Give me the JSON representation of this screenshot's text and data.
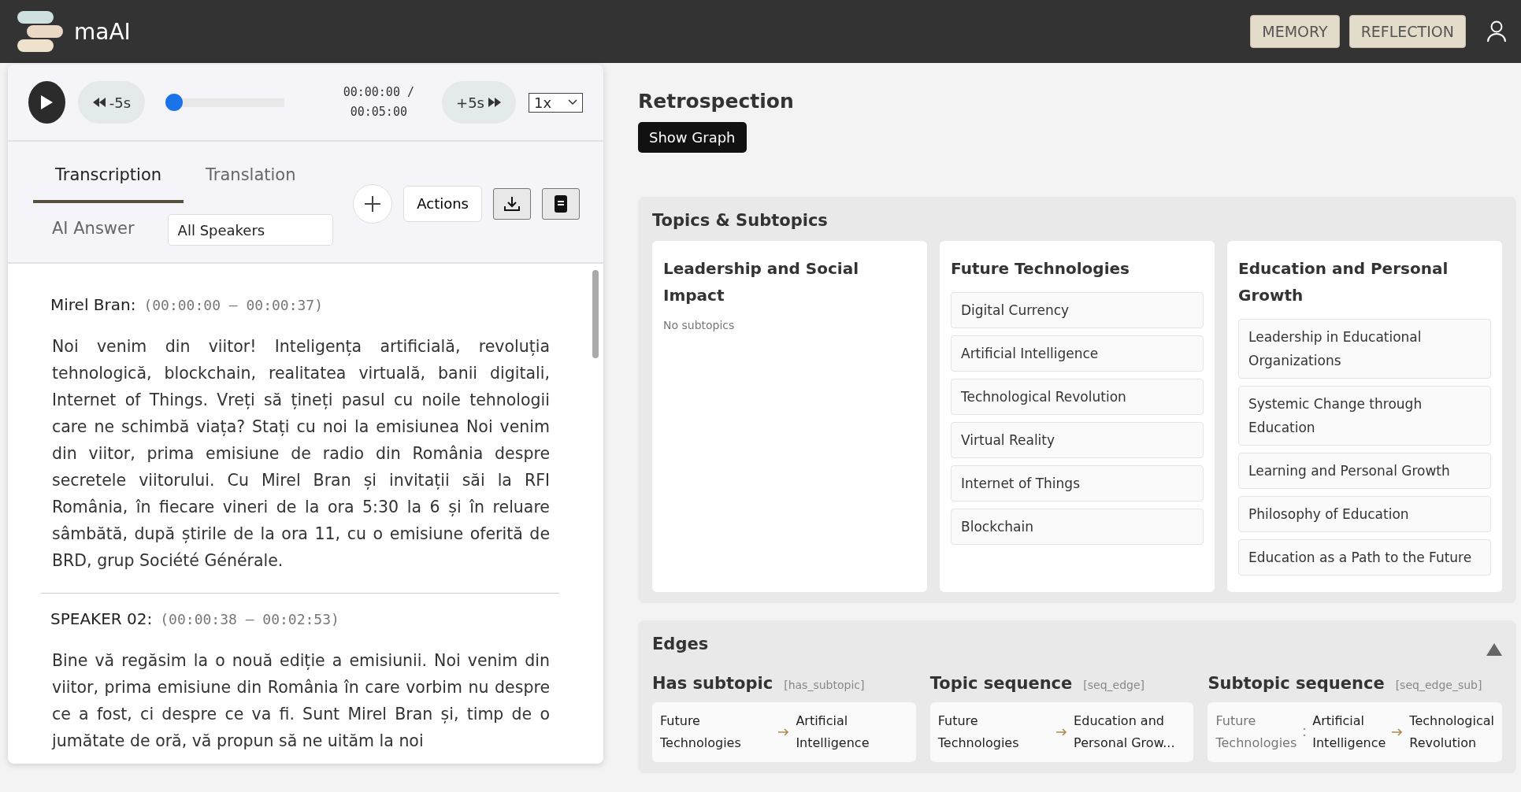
{
  "header": {
    "brand": "maAI",
    "buttons": [
      "MEMORY",
      "REFLECTION"
    ]
  },
  "player": {
    "back": "-5s",
    "forward": "+5s",
    "level": 0,
    "time": "00:00:00 /",
    "duration": "00:05:00",
    "speed": "1x"
  },
  "tabs": [
    {
      "label": "Transcription",
      "selected": true
    },
    {
      "label": "Translation",
      "selected": false
    },
    {
      "label": "AI Answer",
      "selected": false
    }
  ],
  "speaker_filter": "All Speakers",
  "actions": "Actions",
  "transcript": [
    {
      "speaker": "Mirel Bran:",
      "range": "(00:00:00 – 00:00:37)",
      "text": "Noi venim din viitor! Inteligența artificială, revoluția tehnologică, blockchain, realitatea virtuală, banii digitali, Internet of Things. Vreți să țineți pasul cu noile tehnologii care ne schimbă viața? Stați cu noi la emisiunea Noi venim din viitor, prima emisiune de radio din România despre secretele viitorului. Cu Mirel Bran și invitații săi la RFI România, în fiecare vineri de la ora 5:30 la 6 și în reluare sâmbătă, după știrile de la ora 11, cu o emisiune oferită de BRD, grup Société Générale."
    },
    {
      "speaker": "SPEAKER 02:",
      "range": "(00:00:38 – 00:02:53)",
      "text": "Bine vă regăsim la o nouă ediție a emisiunii. Noi venim din viitor, prima emisiune din România în care vorbim nu despre ce a fost, ci despre ce va fi. Sunt Mirel Bran și, timp de o jumătate de oră, vă propun să ne uităm la noi"
    }
  ],
  "retrospection": {
    "title": "Retrospection",
    "button": "Show Graph"
  },
  "topics": {
    "title": "Topics & Subtopics",
    "items": [
      {
        "name": "Leadership and Social Impact",
        "empty": "No subtopics"
      },
      {
        "name": "Future Technologies",
        "subtopics": [
          "Digital Currency",
          "Artificial Intelligence",
          "Technological Revolution",
          "Virtual Reality",
          "Internet of Things",
          "Blockchain"
        ]
      },
      {
        "name": "Education and Personal Growth",
        "subtopics": [
          "Leadership in Educational Organizations",
          "Systemic Change through Education",
          "Learning and Personal Growth",
          "Philosophy of Education",
          "Education as a Path to the Future"
        ]
      }
    ]
  },
  "edges": {
    "title": "Edges",
    "expanded": true,
    "groups": [
      {
        "title": "Has subtopic",
        "tag": "[has_subtopic]",
        "items": [
          {
            "from": "Future Technologies",
            "to": "Artificial Intelligence"
          }
        ]
      },
      {
        "title": "Topic sequence",
        "tag": "[seq_edge]",
        "items": [
          {
            "from": "Future Technologies",
            "to": "Education and Personal Grow..."
          }
        ]
      },
      {
        "title": "Subtopic sequence",
        "tag": "[seq_edge_sub]",
        "items": [
          {
            "parent": "Future Technologies",
            "from": "Artificial Intelligence",
            "to": "Technological Revolution"
          }
        ]
      }
    ]
  }
}
